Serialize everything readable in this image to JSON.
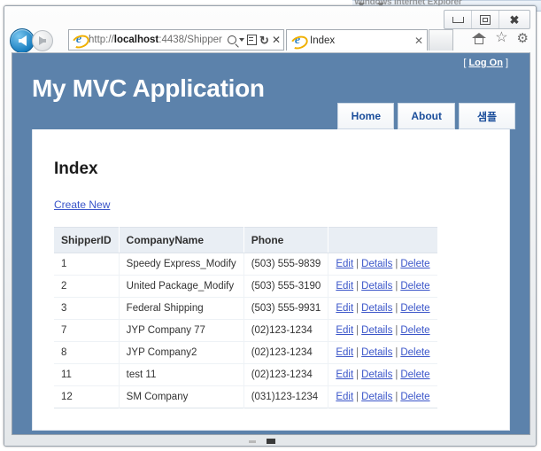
{
  "background_window": {
    "title": "Windows Internet Explorer"
  },
  "browser": {
    "window_controls": {
      "minimize_label": "Minimize",
      "restore_label": "Restore Down",
      "close_label": "Close",
      "close_glyph": "✖"
    },
    "navigation": {
      "back_label": "Back",
      "forward_label": "Forward"
    },
    "address_bar": {
      "url_prefix": "http://",
      "url_host": "localhost",
      "url_suffix": ":4438/Shipper",
      "full_url": "http://localhost:4438/Shipper",
      "search_icon": "search-icon",
      "dropdown_icon": "chevron-down-icon",
      "compatibility_icon": "compatibility-view-icon",
      "refresh_glyph": "↻",
      "stop_glyph": "✕"
    },
    "tab": {
      "label": "Index",
      "close_glyph": "✕"
    },
    "tools": {
      "home_label": "Home",
      "favorites_glyph": "☆",
      "settings_glyph": "⚙"
    }
  },
  "site": {
    "title": "My MVC Application",
    "logon": {
      "bracket_open": "[",
      "link_label": "Log On",
      "bracket_close": "]"
    },
    "nav": [
      {
        "label": "Home"
      },
      {
        "label": "About"
      },
      {
        "label": "샘플"
      }
    ],
    "accent_blue": "#5c82ab",
    "link_blue": "#3a55c9"
  },
  "page": {
    "heading": "Index",
    "create_new_label": "Create New",
    "table": {
      "columns": [
        "ShipperID",
        "CompanyName",
        "Phone",
        ""
      ],
      "action_labels": {
        "edit": "Edit",
        "details": "Details",
        "delete": "Delete",
        "separator": "|"
      },
      "rows": [
        {
          "id": "1",
          "company": "Speedy Express_Modify",
          "phone": "(503) 555-9839"
        },
        {
          "id": "2",
          "company": "United Package_Modify",
          "phone": "(503) 555-3190"
        },
        {
          "id": "3",
          "company": "Federal Shipping",
          "phone": "(503) 555-9931"
        },
        {
          "id": "7",
          "company": "JYP Company 77",
          "phone": "(02)123-1234"
        },
        {
          "id": "8",
          "company": "JYP Company2",
          "phone": "(02)123-1234"
        },
        {
          "id": "11",
          "company": "test 11",
          "phone": "(02)123-1234"
        },
        {
          "id": "12",
          "company": "SM Company",
          "phone": "(031)123-1234"
        }
      ]
    }
  }
}
